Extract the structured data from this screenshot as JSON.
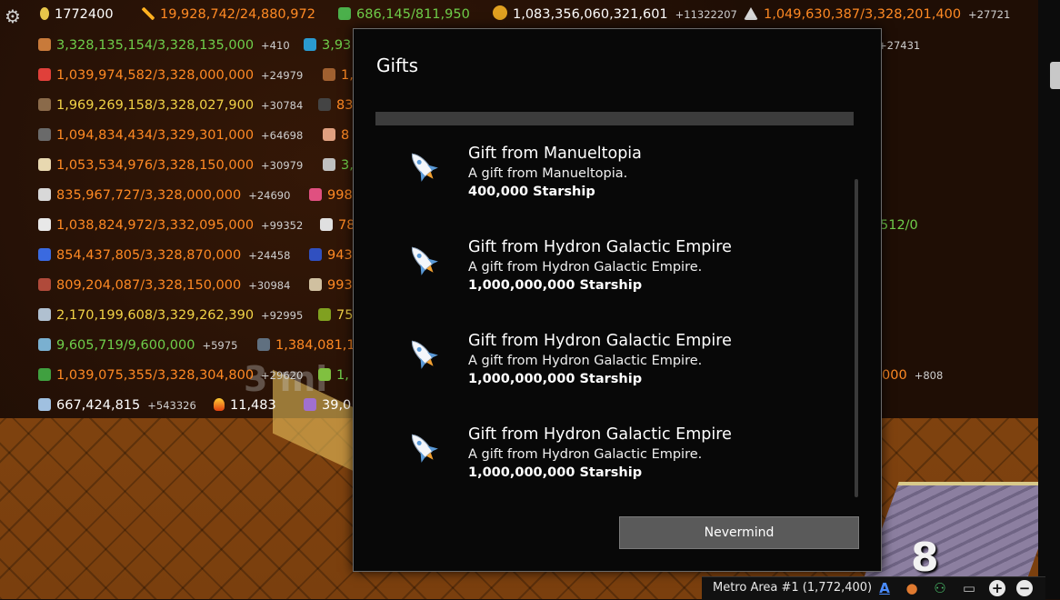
{
  "top_resources": {
    "population": "1772400",
    "power": "19,928,742/24,880,972",
    "network": "686,145/811,950",
    "money": "1,083,356,060,321,601",
    "money_delta": "+11322207",
    "resource_top_right": "1,049,630,387/3,328,201,400",
    "resource_top_right_delta": "+27721"
  },
  "left_resources": [
    {
      "icon": "wood-icon",
      "value": "3,328,135,154/3,328,135,000",
      "delta": "+410",
      "color": "green"
    },
    {
      "icon": "food-icon",
      "value": "1,039,974,582/3,328,000,000",
      "delta": "+24979",
      "color": "orange"
    },
    {
      "icon": "lumber-icon",
      "value": "1,969,269,158/3,328,027,900",
      "delta": "+30784",
      "color": "yellow"
    },
    {
      "icon": "stone-icon",
      "value": "1,094,834,434/3,329,301,000",
      "delta": "+64698",
      "color": "orange"
    },
    {
      "icon": "paper-icon",
      "value": "1,053,534,976/3,328,150,000",
      "delta": "+30979",
      "color": "orange"
    },
    {
      "icon": "iron-icon",
      "value": "835,967,727/3,328,000,000",
      "delta": "+24690",
      "color": "orange"
    },
    {
      "icon": "pipe-icon",
      "value": "1,038,824,972/3,332,095,000",
      "delta": "+99352",
      "color": "orange"
    },
    {
      "icon": "glove-icon",
      "value": "854,437,805/3,328,870,000",
      "delta": "+24458",
      "color": "orange"
    },
    {
      "icon": "brick-icon",
      "value": "809,204,087/3,328,150,000",
      "delta": "+30984",
      "color": "orange"
    },
    {
      "icon": "glass-icon",
      "value": "2,170,199,608/3,329,262,390",
      "delta": "+92995",
      "color": "yellow"
    },
    {
      "icon": "building-icon",
      "value": "9,605,719/9,600,000",
      "delta": "+5975",
      "color": "green"
    },
    {
      "icon": "circuit-icon",
      "value": "1,039,075,355/3,328,304,800",
      "delta": "+29620",
      "color": "orange"
    },
    {
      "icon": "cloud-icon",
      "value": "667,424,815",
      "delta": "+543326",
      "color": "white"
    }
  ],
  "partial_column": [
    "3,93",
    "1,",
    "83",
    "8",
    "3,",
    "998",
    "78",
    "943",
    "993",
    "75",
    "1,384,081,1",
    "1,",
    "39,0"
  ],
  "extra_values": {
    "fire_count": "11,483",
    "right_fragment_1": "+27431",
    "right_fragment_2": "512/0",
    "right_fragment_3": "000",
    "right_fragment_3_delta": "+808",
    "timer_text": "3 mi",
    "tile_number": "8"
  },
  "modal": {
    "title": "Gifts",
    "gifts": [
      {
        "title": "Gift from Manueltopia",
        "description": "A gift from Manueltopia.",
        "amount": "400,000 Starship",
        "icon": "starship-icon"
      },
      {
        "title": "Gift from Hydron Galactic Empire",
        "description": "A gift from Hydron Galactic Empire.",
        "amount": "1,000,000,000 Starship",
        "icon": "starship-icon"
      },
      {
        "title": "Gift from Hydron Galactic Empire",
        "description": "A gift from Hydron Galactic Empire.",
        "amount": "1,000,000,000 Starship",
        "icon": "starship-icon"
      },
      {
        "title": "Gift from Hydron Galactic Empire",
        "description": "A gift from Hydron Galactic Empire.",
        "amount": "1,000,000,000 Starship",
        "icon": "starship-icon"
      }
    ],
    "dismiss_label": "Nevermind"
  },
  "statusbar": {
    "city_label": "Metro Area #1 (1,772,400)",
    "icons": [
      "font-icon",
      "chat-icon",
      "add-user-icon",
      "cast-icon",
      "zoom-in-icon",
      "zoom-out-icon"
    ]
  },
  "colors": {
    "orange": "#ff8a24",
    "green": "#6fce4a",
    "yellow": "#f2d246",
    "white": "#ffffff",
    "modal_bg": "#080808",
    "button_bg": "#5a5a5a"
  }
}
